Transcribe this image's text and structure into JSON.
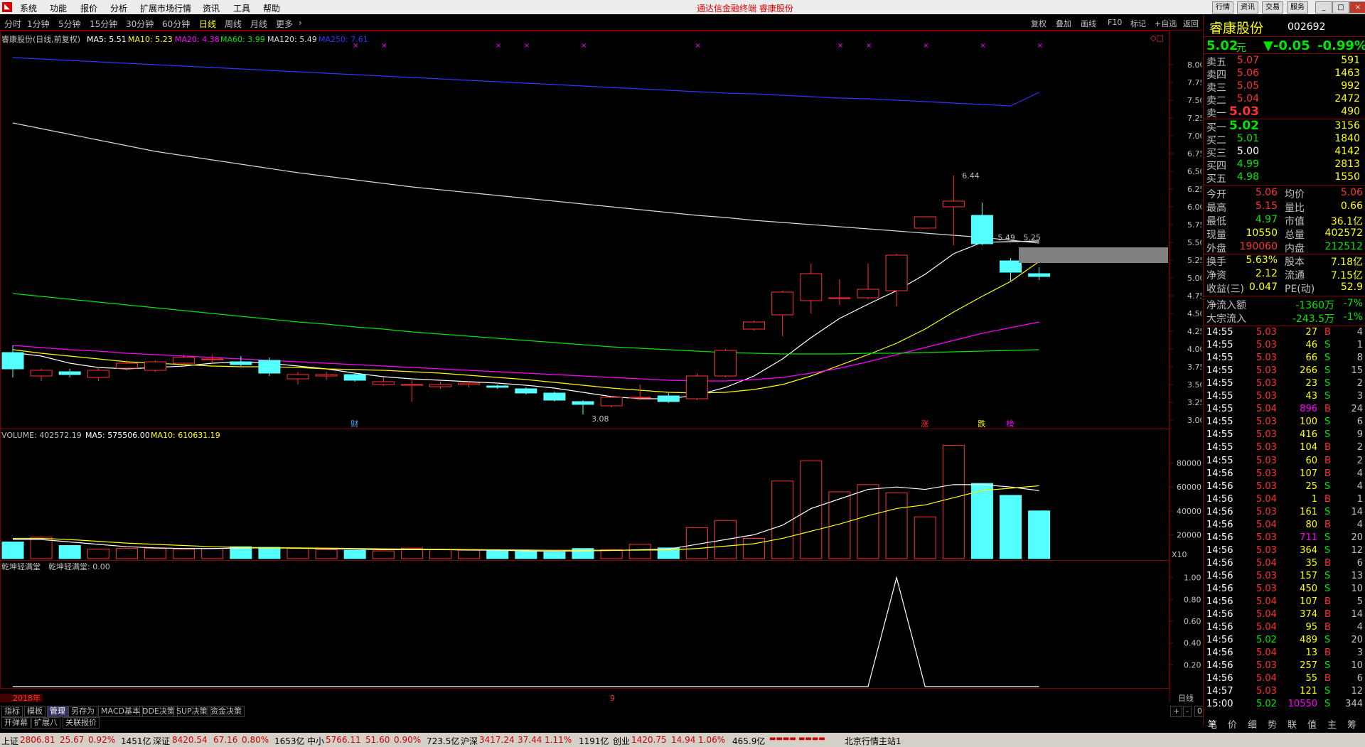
{
  "menu": {
    "items": [
      "系统",
      "功能",
      "报价",
      "分析",
      "扩展市场行情",
      "资讯",
      "工具",
      "帮助"
    ],
    "center_title": "通达信金融终端   睿康股份",
    "right_buttons": [
      "行情",
      "资讯",
      "交易",
      "服务"
    ]
  },
  "period_tabs": [
    "分时",
    "1分钟",
    "5分钟",
    "15分钟",
    "30分钟",
    "60分钟",
    "日线",
    "周线",
    "月线",
    "更多"
  ],
  "selected_period": "日线",
  "tool_buttons": [
    "复权",
    "叠加",
    "画线",
    "F10",
    "标记",
    "+自选",
    "返回"
  ],
  "chart_info": {
    "name": "睿康股份(日线,前复权)",
    "ma5": "MA5: 5.51",
    "ma10": "MA10: 5.23",
    "ma20": "MA20: 4.38",
    "ma60": "MA60: 3.99",
    "ma120": "MA120: 5.49",
    "ma250": "MA250: 7.61"
  },
  "volume_info": {
    "volume": "VOLUME: 402572.19",
    "ma5": "MA5: 575506.00",
    "ma10": "MA10: 610631.19"
  },
  "indicator_info": {
    "name": "乾坤轻满堂",
    "value": "乾坤轻满堂: 0.00"
  },
  "chart_data": [
    {
      "type": "candlestick",
      "ylim": [
        3.0,
        8.1
      ],
      "y_ticks": [
        "8.00",
        "7.75",
        "7.50",
        "7.25",
        "7.00",
        "6.75",
        "6.50",
        "6.25",
        "6.00",
        "5.75",
        "5.50",
        "5.25",
        "5.00",
        "4.75",
        "4.50",
        "4.25",
        "4.00",
        "3.75",
        "3.50",
        "3.25",
        "3.00"
      ],
      "candles": [
        {
          "o": 3.95,
          "h": 4.05,
          "l": 3.6,
          "c": 3.72
        },
        {
          "o": 3.62,
          "h": 3.72,
          "l": 3.55,
          "c": 3.7
        },
        {
          "o": 3.68,
          "h": 3.72,
          "l": 3.6,
          "c": 3.64
        },
        {
          "o": 3.6,
          "h": 3.75,
          "l": 3.55,
          "c": 3.7
        },
        {
          "o": 3.73,
          "h": 3.84,
          "l": 3.7,
          "c": 3.8
        },
        {
          "o": 3.7,
          "h": 3.84,
          "l": 3.68,
          "c": 3.82
        },
        {
          "o": 3.8,
          "h": 3.92,
          "l": 3.76,
          "c": 3.88
        },
        {
          "o": 3.86,
          "h": 3.92,
          "l": 3.8,
          "c": 3.86
        },
        {
          "o": 3.82,
          "h": 3.9,
          "l": 3.76,
          "c": 3.78
        },
        {
          "o": 3.84,
          "h": 3.88,
          "l": 3.62,
          "c": 3.66
        },
        {
          "o": 3.58,
          "h": 3.68,
          "l": 3.5,
          "c": 3.64
        },
        {
          "o": 3.62,
          "h": 3.68,
          "l": 3.56,
          "c": 3.64
        },
        {
          "o": 3.64,
          "h": 3.66,
          "l": 3.54,
          "c": 3.56
        },
        {
          "o": 3.5,
          "h": 3.6,
          "l": 3.48,
          "c": 3.54
        },
        {
          "o": 3.5,
          "h": 3.56,
          "l": 3.26,
          "c": 3.5
        },
        {
          "o": 3.47,
          "h": 3.54,
          "l": 3.44,
          "c": 3.5
        },
        {
          "o": 3.5,
          "h": 3.55,
          "l": 3.46,
          "c": 3.52
        },
        {
          "o": 3.48,
          "h": 3.5,
          "l": 3.44,
          "c": 3.46
        },
        {
          "o": 3.44,
          "h": 3.46,
          "l": 3.36,
          "c": 3.38
        },
        {
          "o": 3.38,
          "h": 3.4,
          "l": 3.26,
          "c": 3.28
        },
        {
          "o": 3.26,
          "h": 3.28,
          "l": 3.08,
          "c": 3.22
        },
        {
          "o": 3.2,
          "h": 3.34,
          "l": 3.18,
          "c": 3.32
        },
        {
          "o": 3.32,
          "h": 3.5,
          "l": 3.28,
          "c": 3.32
        },
        {
          "o": 3.34,
          "h": 3.38,
          "l": 3.24,
          "c": 3.26
        },
        {
          "o": 3.3,
          "h": 3.66,
          "l": 3.28,
          "c": 3.62
        },
        {
          "o": 3.62,
          "h": 4.0,
          "l": 3.6,
          "c": 3.98
        },
        {
          "o": 4.28,
          "h": 4.4,
          "l": 4.26,
          "c": 4.38
        },
        {
          "o": 4.48,
          "h": 4.82,
          "l": 4.18,
          "c": 4.8
        },
        {
          "o": 4.68,
          "h": 5.2,
          "l": 4.5,
          "c": 5.06
        },
        {
          "o": 4.72,
          "h": 4.98,
          "l": 4.62,
          "c": 4.72
        },
        {
          "o": 4.72,
          "h": 5.2,
          "l": 4.7,
          "c": 4.84
        },
        {
          "o": 4.82,
          "h": 5.34,
          "l": 4.6,
          "c": 5.32
        },
        {
          "o": 5.7,
          "h": 5.86,
          "l": 5.7,
          "c": 5.86
        },
        {
          "o": 6.0,
          "h": 6.44,
          "l": 5.46,
          "c": 6.08
        },
        {
          "o": 5.88,
          "h": 6.06,
          "l": 5.46,
          "c": 5.48
        },
        {
          "o": 5.24,
          "h": 5.28,
          "l": 4.96,
          "c": 5.08
        },
        {
          "o": 5.06,
          "h": 5.15,
          "l": 4.97,
          "c": 5.02
        }
      ],
      "ma_lines": {
        "MA5": [
          3.95,
          3.9,
          3.8,
          3.74,
          3.72,
          3.74,
          3.76,
          3.8,
          3.82,
          3.8,
          3.76,
          3.72,
          3.66,
          3.61,
          3.58,
          3.56,
          3.54,
          3.52,
          3.49,
          3.45,
          3.39,
          3.33,
          3.3,
          3.3,
          3.35,
          3.46,
          3.62,
          3.86,
          4.16,
          4.43,
          4.63,
          4.82,
          5.05,
          5.34,
          5.5,
          5.51,
          5.52
        ],
        "MA10": [
          3.99,
          3.94,
          3.9,
          3.86,
          3.82,
          3.8,
          3.78,
          3.76,
          3.75,
          3.75,
          3.74,
          3.72,
          3.71,
          3.7,
          3.68,
          3.66,
          3.63,
          3.6,
          3.57,
          3.53,
          3.49,
          3.45,
          3.42,
          3.39,
          3.38,
          3.39,
          3.43,
          3.5,
          3.62,
          3.77,
          3.92,
          4.08,
          4.28,
          4.52,
          4.74,
          4.95,
          5.23
        ],
        "MA20": [
          4.05,
          4.02,
          3.99,
          3.97,
          3.94,
          3.92,
          3.9,
          3.88,
          3.86,
          3.84,
          3.82,
          3.8,
          3.78,
          3.76,
          3.74,
          3.72,
          3.7,
          3.68,
          3.66,
          3.64,
          3.62,
          3.6,
          3.58,
          3.56,
          3.55,
          3.55,
          3.57,
          3.6,
          3.66,
          3.73,
          3.82,
          3.92,
          4.02,
          4.12,
          4.22,
          4.3,
          4.38
        ],
        "MA60": [
          4.78,
          4.74,
          4.7,
          4.66,
          4.62,
          4.58,
          4.54,
          4.5,
          4.46,
          4.42,
          4.38,
          4.35,
          4.31,
          4.28,
          4.24,
          4.21,
          4.18,
          4.15,
          4.12,
          4.09,
          4.06,
          4.03,
          4.01,
          3.99,
          3.97,
          3.95,
          3.94,
          3.93,
          3.93,
          3.93,
          3.94,
          3.94,
          3.95,
          3.96,
          3.97,
          3.98,
          3.99
        ],
        "MA120": [
          7.18,
          7.1,
          7.02,
          6.94,
          6.86,
          6.78,
          6.72,
          6.66,
          6.6,
          6.54,
          6.48,
          6.43,
          6.38,
          6.33,
          6.28,
          6.24,
          6.2,
          6.16,
          6.12,
          6.08,
          6.04,
          6.0,
          5.96,
          5.92,
          5.88,
          5.85,
          5.81,
          5.78,
          5.75,
          5.72,
          5.69,
          5.66,
          5.63,
          5.6,
          5.57,
          5.53,
          5.49
        ],
        "MA250": [
          8.1,
          8.08,
          8.06,
          8.04,
          8.02,
          8.0,
          7.98,
          7.96,
          7.94,
          7.92,
          7.9,
          7.88,
          7.86,
          7.84,
          7.82,
          7.8,
          7.78,
          7.76,
          7.74,
          7.72,
          7.7,
          7.68,
          7.66,
          7.64,
          7.62,
          7.6,
          7.59,
          7.57,
          7.55,
          7.53,
          7.52,
          7.5,
          7.48,
          7.46,
          7.44,
          7.42,
          7.61
        ]
      },
      "annotations": {
        "high_label": "6.44",
        "low_label": "3.08",
        "ma_marker": "5.49",
        "ma10_marker": "5.25"
      },
      "event_markers": [
        "财",
        "涨",
        "跌",
        "榜"
      ]
    },
    {
      "type": "bar",
      "title": "VOLUME",
      "ylim": [
        0,
        100000
      ],
      "y_ticks": [
        "80000",
        "60000",
        "40000",
        "20000"
      ],
      "unit": "X10",
      "values": [
        14000,
        18000,
        11000,
        8000,
        8500,
        8500,
        8000,
        8500,
        10000,
        9500,
        8500,
        7500,
        7000,
        6500,
        8800,
        7500,
        7000,
        6500,
        6000,
        5500,
        8500,
        7500,
        12000,
        9000,
        26000,
        32000,
        17000,
        65000,
        82000,
        56000,
        62000,
        55000,
        35000,
        95000,
        63000,
        53000,
        40000
      ],
      "ma5": [
        16000,
        16000,
        14000,
        12000,
        10000,
        9000,
        8500,
        8500,
        9000,
        9000,
        8800,
        8300,
        8000,
        7500,
        7500,
        7500,
        7300,
        7000,
        6500,
        6200,
        6500,
        6800,
        7500,
        8000,
        12000,
        16000,
        20000,
        28000,
        42000,
        50000,
        58000,
        60000,
        58000,
        62000,
        62000,
        60000,
        57000
      ],
      "ma10": [
        17000,
        17000,
        16000,
        14500,
        13000,
        12000,
        11000,
        10000,
        9500,
        9200,
        9000,
        8800,
        8500,
        8200,
        8000,
        7800,
        7600,
        7400,
        7200,
        7000,
        7000,
        7000,
        7100,
        7300,
        8500,
        10500,
        12500,
        17000,
        23000,
        29000,
        36000,
        42000,
        45000,
        51000,
        57000,
        59000,
        61000
      ]
    },
    {
      "type": "line",
      "title": "乾坤轻满堂",
      "ylim": [
        0,
        1.05
      ],
      "y_ticks": [
        "1.00",
        "0.80",
        "0.60",
        "0.40",
        "0.20"
      ],
      "values": [
        0,
        0,
        0,
        0,
        0,
        0,
        0,
        0,
        0,
        0,
        0,
        0,
        0,
        0,
        0,
        0,
        0,
        0,
        0,
        0,
        0,
        0,
        0,
        0,
        0,
        0,
        0,
        0,
        0,
        0,
        0,
        1,
        0,
        0,
        0,
        0,
        0
      ]
    }
  ],
  "xaxis": {
    "year_label": "2018年",
    "month_label": "9",
    "right_label": "日线"
  },
  "quote": {
    "name": "睿康股份",
    "code": "002692",
    "price": "5.02",
    "unit": "元",
    "change": "▼-0.05",
    "pct": "-0.99%",
    "asks": [
      {
        "label": "卖五",
        "price": "5.07",
        "vol": "591"
      },
      {
        "label": "卖四",
        "price": "5.06",
        "vol": "1463"
      },
      {
        "label": "卖三",
        "price": "5.05",
        "vol": "992"
      },
      {
        "label": "卖二",
        "price": "5.04",
        "vol": "2472"
      },
      {
        "label": "卖一",
        "price": "5.03",
        "vol": "490"
      }
    ],
    "bids": [
      {
        "label": "买一",
        "price": "5.02",
        "vol": "3156"
      },
      {
        "label": "买二",
        "price": "5.01",
        "vol": "1840"
      },
      {
        "label": "买三",
        "price": "5.00",
        "vol": "4142"
      },
      {
        "label": "买四",
        "price": "4.99",
        "vol": "2813"
      },
      {
        "label": "买五",
        "price": "4.98",
        "vol": "1550"
      }
    ],
    "stats": [
      {
        "l1": "今开",
        "v1": "5.06",
        "c1": "#ff3232",
        "l2": "均价",
        "v2": "5.06",
        "c2": "#ff3232"
      },
      {
        "l1": "最高",
        "v1": "5.15",
        "c1": "#ff3232",
        "l2": "量比",
        "v2": "0.66",
        "c2": "#ffff00"
      },
      {
        "l1": "最低",
        "v1": "4.97",
        "c1": "#00e600",
        "l2": "市值",
        "v2": "36.1亿",
        "c2": "#ffff00"
      },
      {
        "l1": "现量",
        "v1": "10550",
        "c1": "#ffff00",
        "l2": "总量",
        "v2": "402572",
        "c2": "#ffff00"
      },
      {
        "l1": "外盘",
        "v1": "190060",
        "c1": "#ff3232",
        "l2": "内盘",
        "v2": "212512",
        "c2": "#00e600"
      },
      {
        "l1": "换手",
        "v1": "5.63%",
        "c1": "#ffff00",
        "l2": "股本",
        "v2": "7.18亿",
        "c2": "#ffff00"
      },
      {
        "l1": "净资",
        "v1": "2.12",
        "c1": "#ffff00",
        "l2": "流通",
        "v2": "7.15亿",
        "c2": "#ffff00"
      },
      {
        "l1": "收益(三)",
        "v1": "0.047",
        "c1": "#ffff00",
        "l2": "PE(动)",
        "v2": "52.9",
        "c2": "#ffff00"
      }
    ],
    "flows": [
      {
        "label": "净流入额",
        "value": "-1360万",
        "pct": "-7%"
      },
      {
        "label": "大宗流入",
        "value": "-243.5万",
        "pct": "-1%"
      }
    ]
  },
  "ticks": [
    {
      "t": "14:55",
      "p": "5.03",
      "v": "27",
      "d": "B",
      "n": "4"
    },
    {
      "t": "14:55",
      "p": "5.03",
      "v": "46",
      "d": "S",
      "n": "1"
    },
    {
      "t": "14:55",
      "p": "5.03",
      "v": "66",
      "d": "S",
      "n": "8"
    },
    {
      "t": "14:55",
      "p": "5.03",
      "v": "266",
      "d": "S",
      "n": "15"
    },
    {
      "t": "14:55",
      "p": "5.03",
      "v": "23",
      "d": "S",
      "n": "2"
    },
    {
      "t": "14:55",
      "p": "5.03",
      "v": "43",
      "d": "S",
      "n": "3"
    },
    {
      "t": "14:55",
      "p": "5.04",
      "v": "896",
      "d": "B",
      "n": "24"
    },
    {
      "t": "14:55",
      "p": "5.03",
      "v": "100",
      "d": "S",
      "n": "6"
    },
    {
      "t": "14:55",
      "p": "5.03",
      "v": "416",
      "d": "S",
      "n": "9"
    },
    {
      "t": "14:55",
      "p": "5.03",
      "v": "104",
      "d": "B",
      "n": "2"
    },
    {
      "t": "14:55",
      "p": "5.03",
      "v": "60",
      "d": "B",
      "n": "2"
    },
    {
      "t": "14:56",
      "p": "5.03",
      "v": "107",
      "d": "B",
      "n": "4"
    },
    {
      "t": "14:56",
      "p": "5.03",
      "v": "25",
      "d": "S",
      "n": "4"
    },
    {
      "t": "14:56",
      "p": "5.04",
      "v": "1",
      "d": "B",
      "n": "1"
    },
    {
      "t": "14:56",
      "p": "5.03",
      "v": "161",
      "d": "S",
      "n": "14"
    },
    {
      "t": "14:56",
      "p": "5.04",
      "v": "80",
      "d": "B",
      "n": "4"
    },
    {
      "t": "14:56",
      "p": "5.03",
      "v": "711",
      "d": "S",
      "n": "20"
    },
    {
      "t": "14:56",
      "p": "5.03",
      "v": "364",
      "d": "S",
      "n": "12"
    },
    {
      "t": "14:56",
      "p": "5.04",
      "v": "35",
      "d": "B",
      "n": "6"
    },
    {
      "t": "14:56",
      "p": "5.03",
      "v": "157",
      "d": "S",
      "n": "13"
    },
    {
      "t": "14:56",
      "p": "5.03",
      "v": "450",
      "d": "S",
      "n": "10"
    },
    {
      "t": "14:56",
      "p": "5.04",
      "v": "107",
      "d": "B",
      "n": "5"
    },
    {
      "t": "14:56",
      "p": "5.04",
      "v": "374",
      "d": "B",
      "n": "14"
    },
    {
      "t": "14:56",
      "p": "5.04",
      "v": "95",
      "d": "B",
      "n": "4"
    },
    {
      "t": "14:56",
      "p": "5.02",
      "v": "489",
      "d": "S",
      "n": "20"
    },
    {
      "t": "14:56",
      "p": "5.04",
      "v": "13",
      "d": "B",
      "n": "3"
    },
    {
      "t": "14:56",
      "p": "5.03",
      "v": "257",
      "d": "S",
      "n": "10"
    },
    {
      "t": "14:56",
      "p": "5.04",
      "v": "55",
      "d": "B",
      "n": "6"
    },
    {
      "t": "14:57",
      "p": "5.03",
      "v": "121",
      "d": "S",
      "n": "12"
    },
    {
      "t": "15:00",
      "p": "5.02",
      "v": "10550",
      "d": "S",
      "n": "344"
    }
  ],
  "right_tabs": [
    "笔",
    "价",
    "细",
    "势",
    "联",
    "值",
    "主",
    "筹"
  ],
  "bottom_tabs_row1": [
    "指标",
    "模板",
    "管理",
    "另存为",
    "MACD基本",
    "DDE决策",
    "SUP决策",
    "资金决策"
  ],
  "bottom_tabs_row2": [
    "开弹幕",
    "扩展八",
    "关联报价"
  ],
  "status": {
    "sh": "上证",
    "sh_v": "2806.81",
    "sh_c": "25.67",
    "sh_p": "0.92%",
    "sh_a": "1451亿",
    "sz": "深证",
    "sz_v": "8420.54",
    "sz_c": "67.16",
    "sz_p": "0.80%",
    "sz_a": "1653亿",
    "zx": "中小",
    "zx_v": "5766.11",
    "zx_c": "51.60",
    "zx_p": "0.90%",
    "zx_a": "723.5亿",
    "hs": "沪深",
    "hs_v": "3417.24",
    "hs_c": "37.44",
    "hs_p": "1.11%",
    "hs_a": "1191亿",
    "cy": "创业",
    "cy_v": "1420.75",
    "cy_c": "14.94",
    "cy_p": "1.06%",
    "cy_a": "465.9亿",
    "station": "北京行情主站1"
  },
  "colors": {
    "up": "#ff3232",
    "down": "#54ffff",
    "ma5": "#ffffff",
    "ma10": "#ffff00",
    "ma20": "#ff00ff",
    "ma60": "#00e600",
    "ma120": "#d8d8d8",
    "ma250": "#3232ff"
  }
}
